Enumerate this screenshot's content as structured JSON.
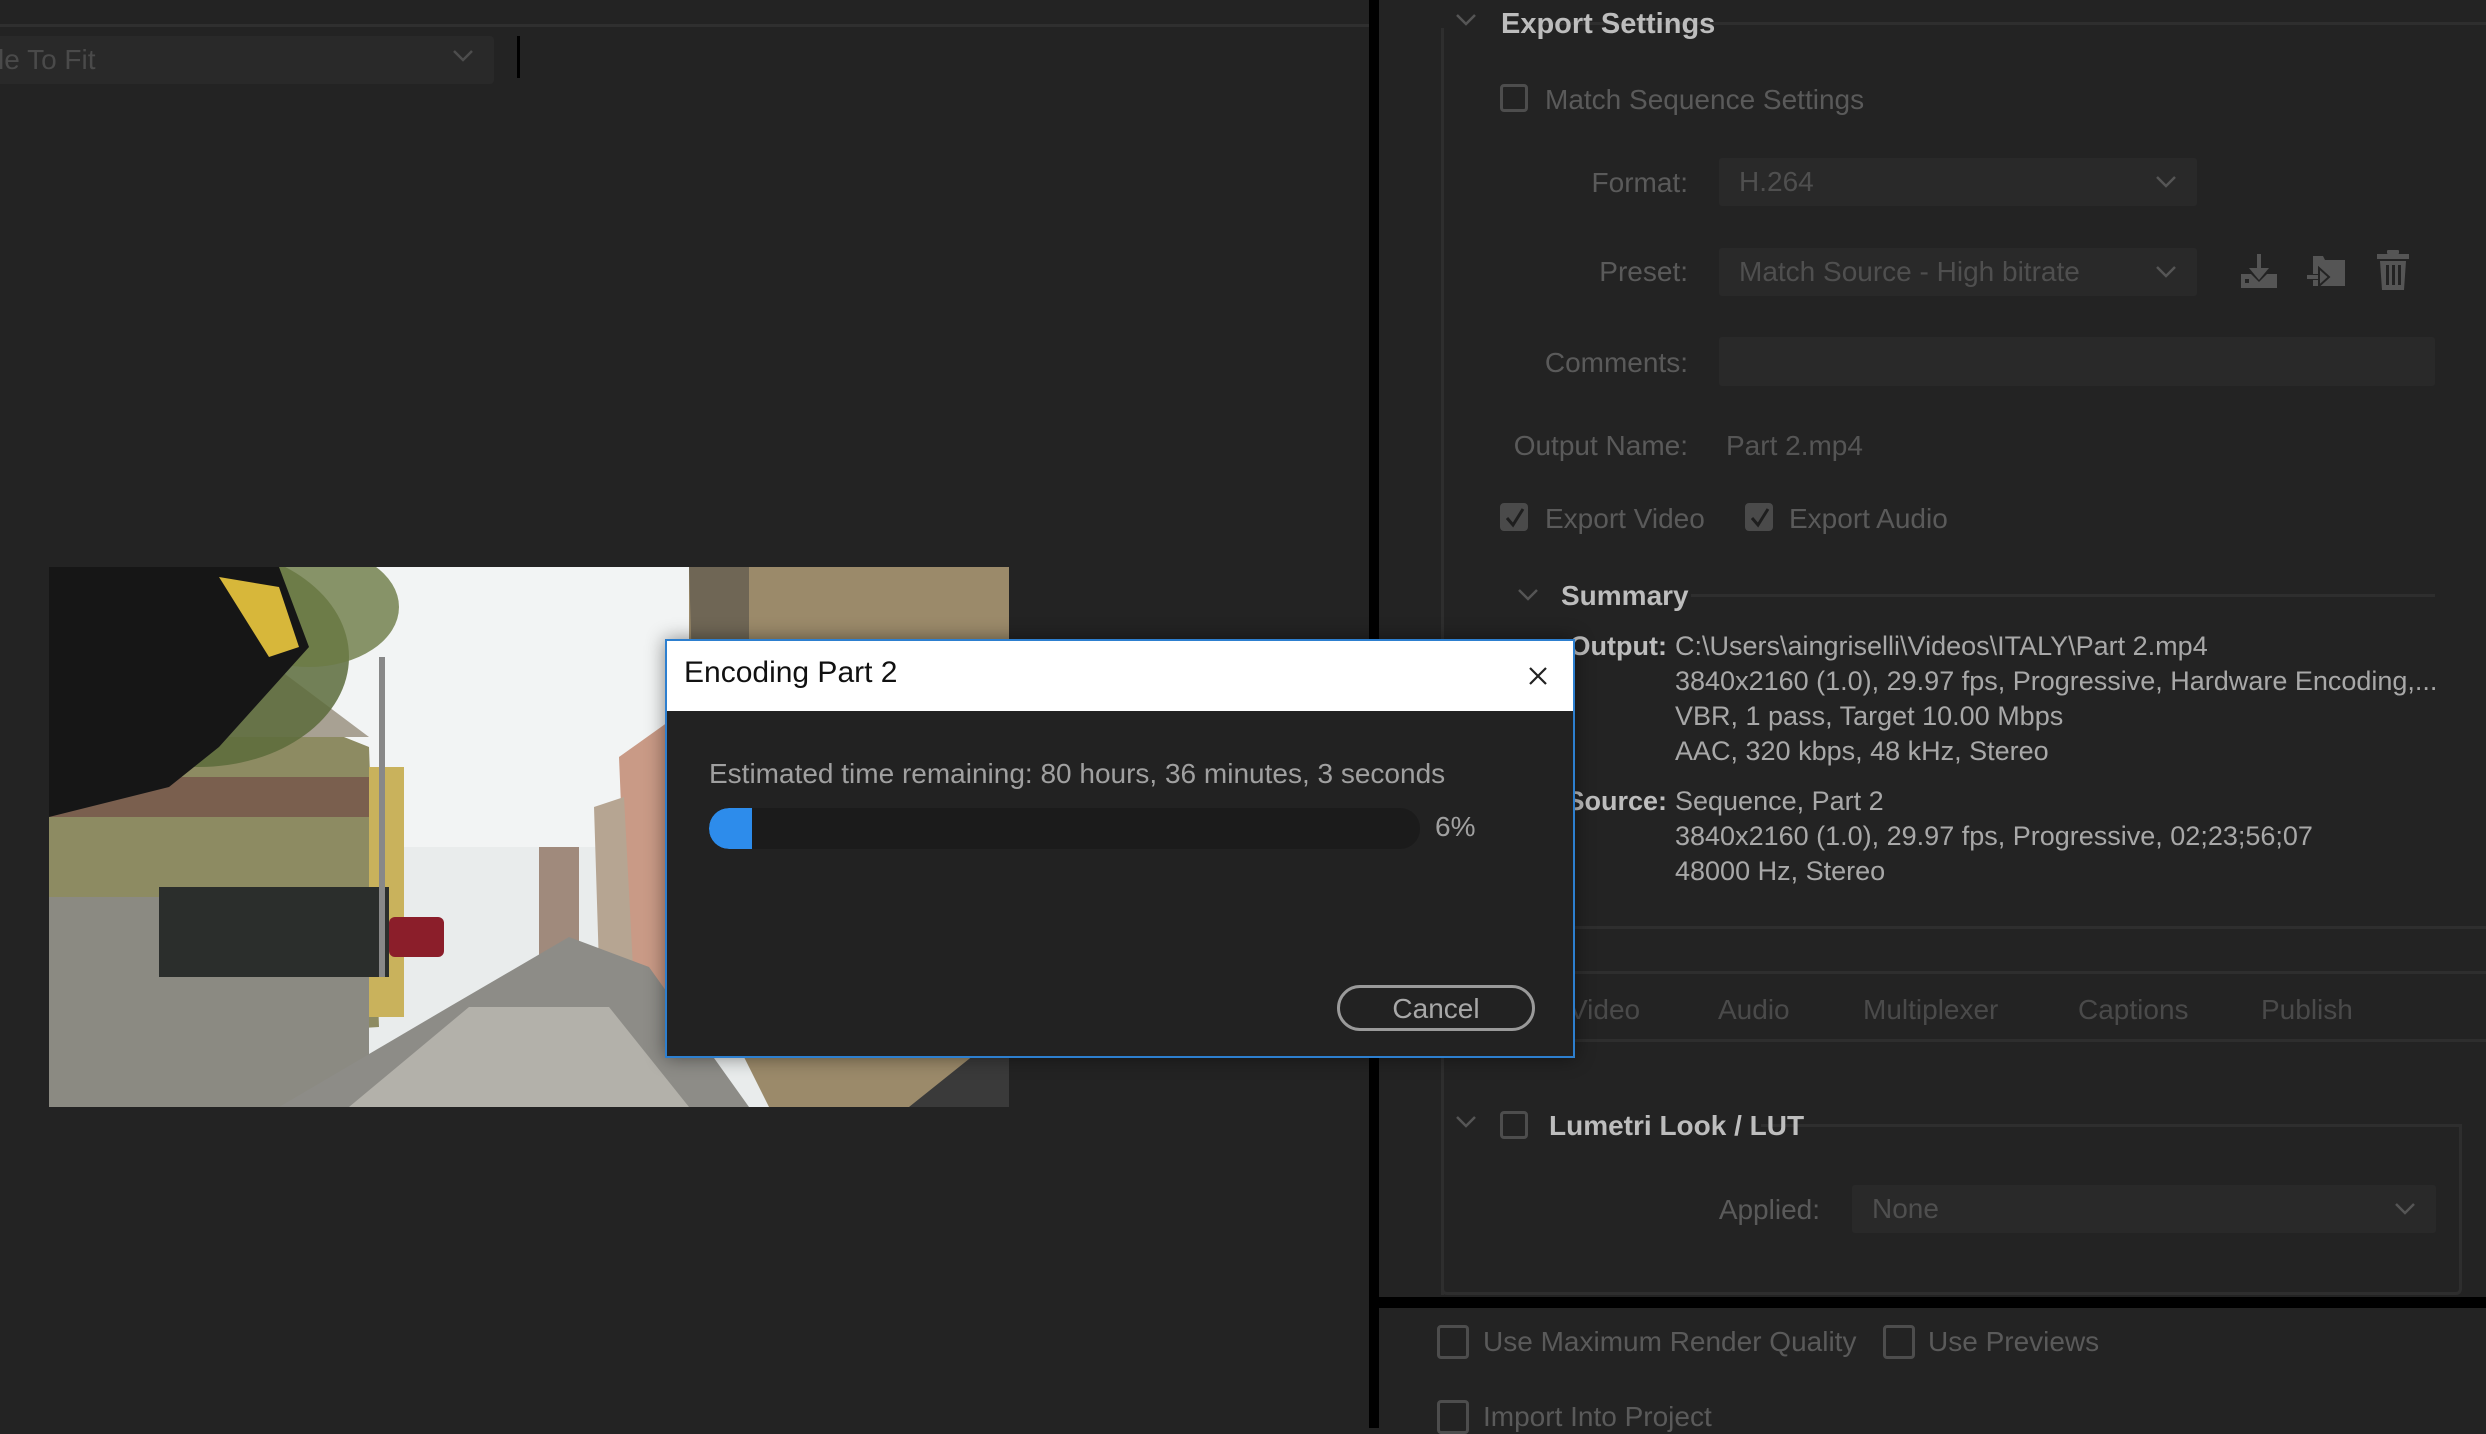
{
  "left_panel": {
    "fit_dropdown": {
      "value": "le To Fit"
    }
  },
  "export_settings": {
    "title": "Export Settings",
    "match_sequence": {
      "label": "Match Sequence Settings",
      "checked": false
    },
    "format": {
      "label": "Format:",
      "value": "H.264"
    },
    "preset": {
      "label": "Preset:",
      "value": "Match Source - High bitrate",
      "icons": [
        "save-preset-icon",
        "import-preset-icon",
        "delete-preset-icon"
      ]
    },
    "comments": {
      "label": "Comments:",
      "value": ""
    },
    "output_name": {
      "label": "Output Name:",
      "value": "Part 2.mp4"
    },
    "export_video": {
      "label": "Export Video",
      "checked": true
    },
    "export_audio": {
      "label": "Export Audio",
      "checked": true
    },
    "summary": {
      "title": "Summary",
      "output_label": "Output:",
      "output_lines": [
        "C:\\Users\\aingriselli\\Videos\\ITALY\\Part 2.mp4",
        "3840x2160 (1.0), 29.97 fps, Progressive, Hardware Encoding,...",
        "VBR, 1 pass, Target 10.00 Mbps",
        "AAC, 320 kbps, 48 kHz, Stereo"
      ],
      "source_label": "Source:",
      "source_lines": [
        "Sequence, Part 2",
        "3840x2160 (1.0), 29.97 fps, Progressive, 02;23;56;07",
        "48000 Hz, Stereo"
      ]
    }
  },
  "tabs": [
    {
      "label": "Video"
    },
    {
      "label": "Audio"
    },
    {
      "label": "Multiplexer"
    },
    {
      "label": "Captions"
    },
    {
      "label": "Publish"
    }
  ],
  "lumetri": {
    "title": "Lumetri Look / LUT",
    "checked": false,
    "applied_label": "Applied:",
    "applied_value": "None"
  },
  "bottom_options": {
    "max_render_quality": {
      "label": "Use Maximum Render Quality",
      "checked": false
    },
    "use_previews": {
      "label": "Use Previews",
      "checked": false
    },
    "import_into_project": {
      "label": "Import Into Project",
      "checked": false
    }
  },
  "dialog": {
    "title": "Encoding Part 2",
    "eta": "Estimated time remaining: 80 hours, 36 minutes, 3 seconds",
    "progress_percent": 6,
    "progress_label": "6%",
    "cancel_label": "Cancel",
    "accent_color": "#2d8ceb"
  }
}
